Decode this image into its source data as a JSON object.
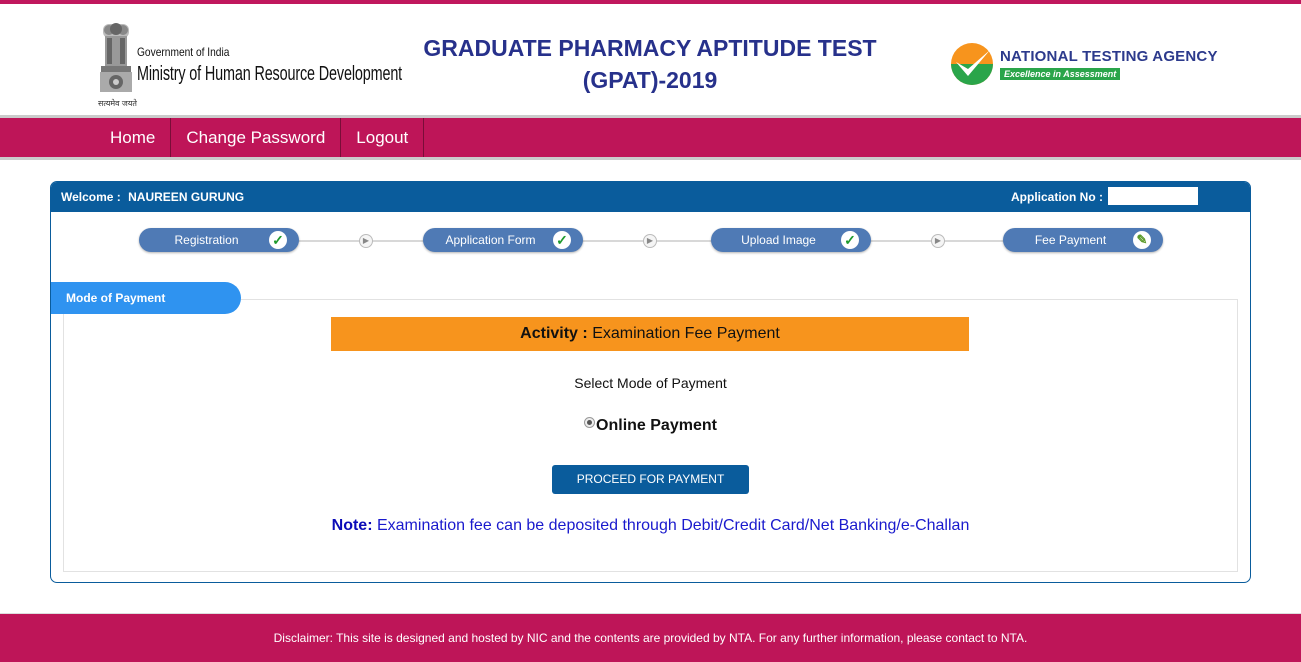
{
  "header": {
    "gov_label": "Government of India",
    "ministry_label": "Ministry of Human Resource Development",
    "emblem_caption": "सत्यमेव जयते",
    "title_line1": "GRADUATE PHARMACY APTITUDE TEST",
    "title_line2": "(GPAT)-2019",
    "nta_name": "NATIONAL TESTING AGENCY",
    "nta_tagline": "Excellence in Assessment"
  },
  "nav": {
    "items": [
      {
        "label": "Home"
      },
      {
        "label": "Change Password"
      },
      {
        "label": "Logout"
      }
    ]
  },
  "panel": {
    "welcome_label": "Welcome :",
    "user_name": "NAUREEN GURUNG",
    "app_no_label": "Application No :",
    "app_no_value": "",
    "steps": [
      {
        "label": "Registration",
        "status": "complete",
        "icon": "✓"
      },
      {
        "label": "Application Form",
        "status": "complete",
        "icon": "✓"
      },
      {
        "label": "Upload Image",
        "status": "complete",
        "icon": "✓"
      },
      {
        "label": "Fee Payment",
        "status": "in-progress",
        "icon": "✎"
      }
    ],
    "arrow_glyph": "▶"
  },
  "payment": {
    "section_tab": "Mode of Payment",
    "activity_label": "Activity :",
    "activity_value": "Examination Fee Payment",
    "select_label": "Select Mode of Payment",
    "option_label": "Online Payment",
    "option_selected": true,
    "proceed_button": "PROCEED FOR PAYMENT",
    "note_label": "Note:",
    "note_text": "Examination fee can be deposited through Debit/Credit Card/Net Banking/e-Challan"
  },
  "footer": {
    "disclaimer": "Disclaimer: This site is designed and hosted by NIC and the contents are provided by NTA. For any further information, please contact to NTA."
  },
  "colors": {
    "brand_magenta": "#be1558",
    "panel_blue": "#0a5c9c",
    "step_blue": "#4f7ab5",
    "tab_blue": "#2f93f0",
    "activity_orange": "#f7941d",
    "note_blue": "#1a1acd",
    "title_navy": "#27318b"
  }
}
